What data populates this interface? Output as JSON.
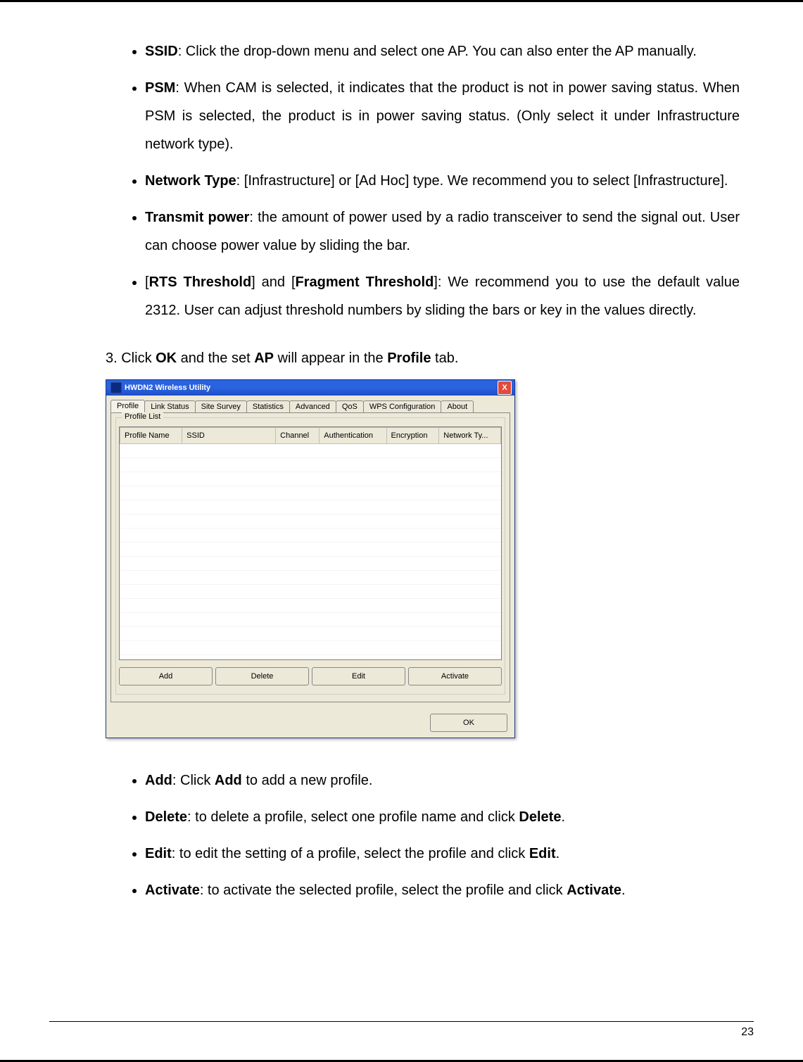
{
  "bullets_a": [
    {
      "term": "SSID",
      "text": ": Click the drop-down menu and select one AP. You can also enter the AP manually."
    },
    {
      "term": "PSM",
      "text": ": When CAM is selected, it indicates that the product is not in power saving status. When PSM is selected, the product is in power saving status. (Only select it under Infrastructure network type)."
    },
    {
      "term": "Network Type",
      "text": ": [Infrastructure] or [Ad Hoc] type. We recommend you to select [Infrastructure]."
    },
    {
      "term": "Transmit power",
      "text": ": the amount of power used by a radio transceiver to send the signal out. User can choose power value by sliding the bar."
    }
  ],
  "bullet_threshold": {
    "open": "[",
    "term1": "RTS Threshold",
    "mid": "] and [",
    "term2": "Fragment Threshold",
    "after": "]: We recommend you to use the default value 2312. User can adjust threshold numbers by sliding the bars or key in the values directly."
  },
  "step3": {
    "pre": "3. Click ",
    "b1": "OK",
    "mid1": " and the set ",
    "b2": "AP",
    "mid2": " will appear in the ",
    "b3": "Profile",
    "post": " tab."
  },
  "window": {
    "title": "HWDN2 Wireless Utility",
    "close": "X",
    "tabs": [
      "Profile",
      "Link Status",
      "Site Survey",
      "Statistics",
      "Advanced",
      "QoS",
      "WPS Configuration",
      "About"
    ],
    "groupbox": "Profile List",
    "columns": [
      "Profile Name",
      "SSID",
      "Channel",
      "Authentication",
      "Encryption",
      "Network Ty..."
    ],
    "buttons": [
      "Add",
      "Delete",
      "Edit",
      "Activate"
    ],
    "ok": "OK"
  },
  "bullets_b": [
    {
      "term": "Add",
      "pre": ": Click ",
      "mid_term": "Add",
      "text": " to add a new profile."
    },
    {
      "term": "Delete",
      "pre": ": to delete a profile, select one profile name and click ",
      "mid_term": "Delete",
      "text": "."
    },
    {
      "term": "Edit",
      "pre": ": to edit the setting of a profile, select the profile and click ",
      "mid_term": "Edit",
      "text": "."
    },
    {
      "term": "Activate",
      "pre": ": to activate the selected profile, select the profile and click ",
      "mid_term": "Activate",
      "text": "."
    }
  ],
  "page_number": "23"
}
